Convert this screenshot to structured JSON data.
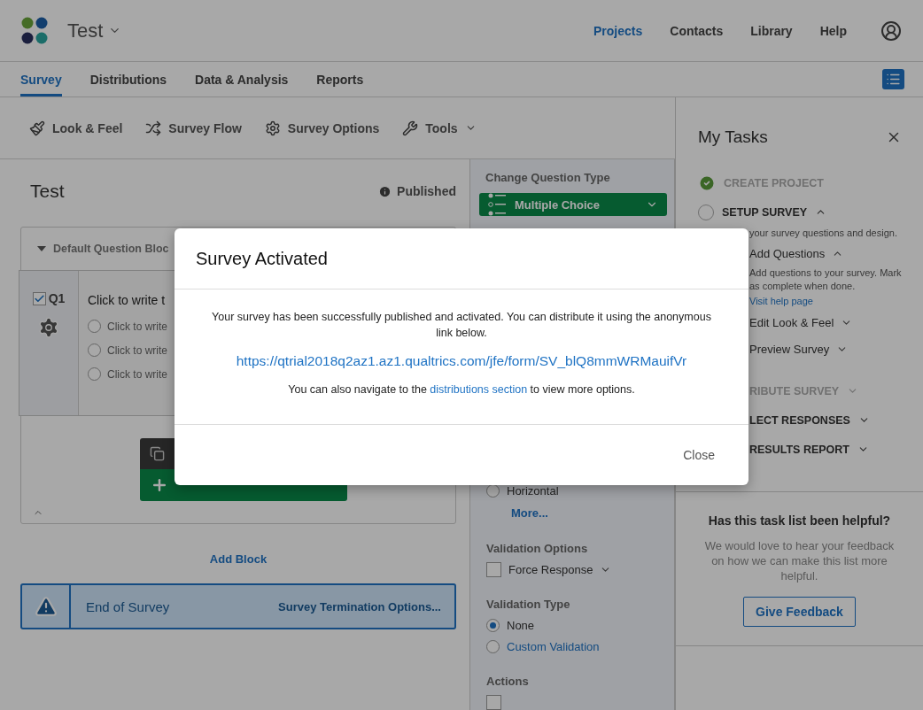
{
  "header": {
    "project_title": "Test",
    "nav": [
      {
        "label": "Projects",
        "selected": true
      },
      {
        "label": "Contacts",
        "selected": false
      },
      {
        "label": "Library",
        "selected": false
      },
      {
        "label": "Help",
        "selected": false
      }
    ]
  },
  "tabs": [
    {
      "label": "Survey",
      "selected": true
    },
    {
      "label": "Distributions",
      "selected": false
    },
    {
      "label": "Data & Analysis",
      "selected": false
    },
    {
      "label": "Reports",
      "selected": false
    }
  ],
  "toolbar": [
    {
      "label": "Look & Feel",
      "kind": "brush"
    },
    {
      "label": "Survey Flow",
      "kind": "flow"
    },
    {
      "label": "Survey Options",
      "kind": "gear"
    },
    {
      "label": "Tools",
      "kind": "wrench"
    }
  ],
  "survey": {
    "title": "Test",
    "status": "Published",
    "block": {
      "title": "Default Question Bloc",
      "expanded": true,
      "question": {
        "number": "Q1",
        "checked": true,
        "text": "Click to write t",
        "choices": [
          {
            "label": "Click to write",
            "selected": false
          },
          {
            "label": "Click to write",
            "selected": false
          },
          {
            "label": "Click to write",
            "selected": false
          }
        ]
      }
    },
    "add_block": "Add Block",
    "end": {
      "title": "End of Survey",
      "options": "Survey Termination Options..."
    }
  },
  "question_panel": {
    "type_label": "Change Question Type",
    "type_value": "Multiple Choice",
    "items": [
      {
        "kind": "radio",
        "label": "Horizontal",
        "selected": false
      },
      {
        "kind": "link",
        "label": "More..."
      },
      {
        "kind": "heading",
        "label": "Validation Options"
      },
      {
        "kind": "checkbox",
        "label": "Force Response",
        "checked": false
      },
      {
        "kind": "heading",
        "label": "Validation Type"
      },
      {
        "kind": "radio",
        "label": "None",
        "selected": true
      },
      {
        "kind": "radio-link",
        "label": "Custom Validation",
        "selected": false
      },
      {
        "kind": "heading",
        "label": "Actions"
      },
      {
        "kind": "checkbox",
        "checked": false
      }
    ]
  },
  "tasks": {
    "title": "My Tasks",
    "items": [
      {
        "kind": "section",
        "label": "CREATE PROJECT",
        "done": true,
        "disabled": true
      },
      {
        "kind": "section",
        "label": "SETUP SURVEY",
        "done": false,
        "disabled": false,
        "expanded": true
      },
      {
        "kind": "note",
        "text": "your survey questions and design."
      },
      {
        "kind": "step",
        "label": "Add Questions",
        "expanded": true
      },
      {
        "kind": "note",
        "text": "Add questions to your survey. Mark as complete when done."
      },
      {
        "kind": "link",
        "text": "Visit help page"
      },
      {
        "kind": "step",
        "label": "Edit Look & Feel",
        "expanded": false
      },
      {
        "kind": "step",
        "label": "Preview Survey",
        "expanded": false
      },
      {
        "kind": "clipped-section",
        "label": "RIBUTE SURVEY",
        "disabled": true,
        "expanded": false
      },
      {
        "kind": "clipped-section",
        "label": "LECT RESPONSES",
        "disabled": false,
        "expanded": false
      },
      {
        "kind": "clipped-section",
        "label": "RESULTS REPORT",
        "disabled": false,
        "expanded": false
      }
    ],
    "feedback": {
      "title": "Has this task list been helpful?",
      "text": "We would love to hear your feedback on how we can make this list more helpful.",
      "button": "Give Feedback"
    }
  },
  "modal": {
    "title": "Survey Activated",
    "message": "Your survey has been successfully published and activated. You can distribute it using the anonymous link below.",
    "link": "https://qtrial2018q2az1.az1.qualtrics.com/jfe/form/SV_blQ8mmWRMauifVr",
    "note_before": "You can also navigate to the ",
    "note_link": "distributions section",
    "note_after": " to view more options.",
    "close": "Close"
  }
}
